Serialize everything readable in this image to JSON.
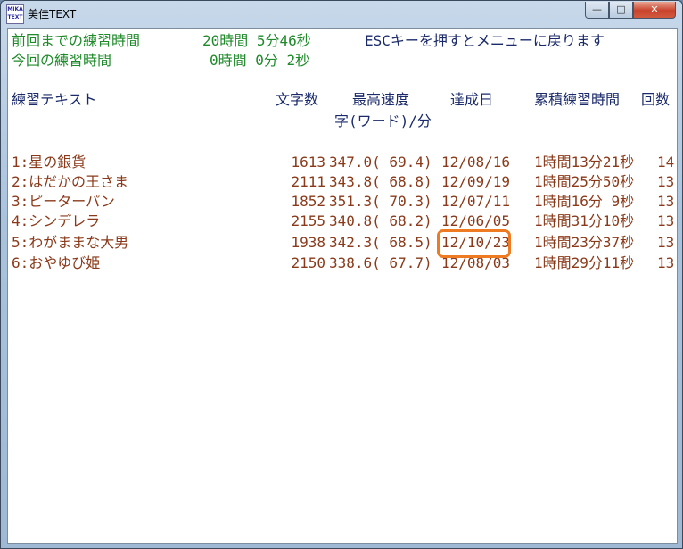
{
  "window": {
    "icon_text": "MIKA TEXT",
    "title": "美佳TEXT",
    "minimize": "—",
    "maximize": "□",
    "close": "✕"
  },
  "status": {
    "prev_label": "前回までの練習時間",
    "prev_value": "20時間 5分46秒",
    "esc_hint": "ESCキーを押すとメニューに戻ります",
    "current_label": "今回の練習時間",
    "current_value": "0時間 0分 2秒"
  },
  "table": {
    "headers": {
      "text": "練習テキスト",
      "chars": "文字数",
      "max_speed": "最高速度",
      "speed_unit": "字(ワード)/分",
      "date": "達成日",
      "total_time": "累積練習時間",
      "count": "回数"
    },
    "rows": [
      {
        "name": "1:星の銀貨",
        "chars": "1613",
        "speed": "347.0( 69.4)",
        "date": "12/08/16",
        "time": "1時間13分21秒",
        "count": "14"
      },
      {
        "name": "2:はだかの王さま",
        "chars": "2111",
        "speed": "343.8( 68.8)",
        "date": "12/09/19",
        "time": "1時間25分50秒",
        "count": "13"
      },
      {
        "name": "3:ピーターパン",
        "chars": "1852",
        "speed": "351.3( 70.3)",
        "date": "12/07/11",
        "time": "1時間16分 9秒",
        "count": "13"
      },
      {
        "name": "4:シンデレラ",
        "chars": "2155",
        "speed": "340.8( 68.2)",
        "date": "12/06/05",
        "time": "1時間31分10秒",
        "count": "13"
      },
      {
        "name": "5:わがままな大男",
        "chars": "1938",
        "speed": "342.3( 68.5)",
        "date": "12/10/23",
        "time": "1時間23分37秒",
        "count": "13"
      },
      {
        "name": "6:おやゆび姫",
        "chars": "2150",
        "speed": "338.6( 67.7)",
        "date": "12/08/03",
        "time": "1時間29分11秒",
        "count": "13"
      }
    ]
  },
  "colors": {
    "green": "#1f8a2a",
    "navy": "#1a2a6a",
    "brown": "#8a3a1a",
    "highlight": "#ee7b22"
  }
}
